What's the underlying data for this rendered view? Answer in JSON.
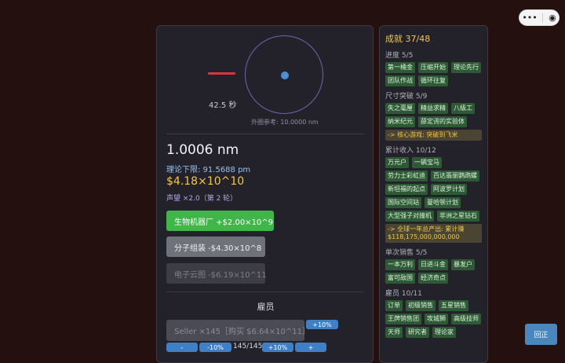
{
  "capsule": {
    "more_glyph": "•••",
    "close_glyph": "◉"
  },
  "main": {
    "timer": "42.5 秒",
    "outer_ref": "外圈参考: 10.0000 nm",
    "size": "1.0006 nm",
    "theory_limit": "理论下限: 91.5688 pm",
    "money": "$4.18×10^10",
    "prestige": "声望 ×2.0（第 2 轮）",
    "buttons": [
      {
        "label": "生物机器厂  +$2.00×10^9"
      },
      {
        "label": "分子组装  -$4.30×10^8"
      },
      {
        "label": "电子云图  -$6.19×10^11"
      }
    ],
    "employees": {
      "title": "雇员",
      "seller": "Seller ×145［购买 $6.64×10^11］",
      "pct_top": "+10%",
      "minus": "-",
      "minus_pct": "-10%",
      "count": "145/145",
      "plus_pct": "+10%",
      "plus": "+"
    }
  },
  "achievements": {
    "title": "成就 37/48",
    "sections": [
      {
        "header": "进度 5/5",
        "items": [
          "第一桶金",
          "压缩开始",
          "理论先行",
          "团队作战",
          "循环往复"
        ]
      },
      {
        "header": "尺寸突破 5/9",
        "items": [
          "失之毫厘",
          "精益求精",
          "八级工",
          "纳米纪元",
          "薛定谔的实验体"
        ],
        "hint": "-> 核心游戏: 突破到飞米"
      },
      {
        "header": "累计收入 10/12",
        "items": [
          "万元户",
          "一辆宝马",
          "劳力士彩虹迪",
          "百达翡丽鹦鹉螺",
          "新坦福的起点",
          "阿波罗计划",
          "国际空间站",
          "曼哈顿计划",
          "大型强子对撞机",
          "非洲之星钻石"
        ],
        "hint": "-> 全球一年总产出: 累计赚 $118,175,000,000,000"
      },
      {
        "header": "单次销售 5/5",
        "items": [
          "一本万利",
          "日进斗金",
          "暴发户",
          "富可敌国",
          "经济奇点"
        ]
      },
      {
        "header": "雇员 10/11",
        "items": [
          "订单",
          "初级销售",
          "五星销售",
          "王牌销售团",
          "攻城狮",
          "高级技师",
          "天师",
          "研究者",
          "理论家"
        ]
      }
    ]
  },
  "return_button": "回正",
  "colors": {
    "accent_green": "#3fb54a",
    "money_gold": "#f3c54a",
    "pill_blue": "#3f7fc6",
    "chip_green": "#2d5a35"
  }
}
